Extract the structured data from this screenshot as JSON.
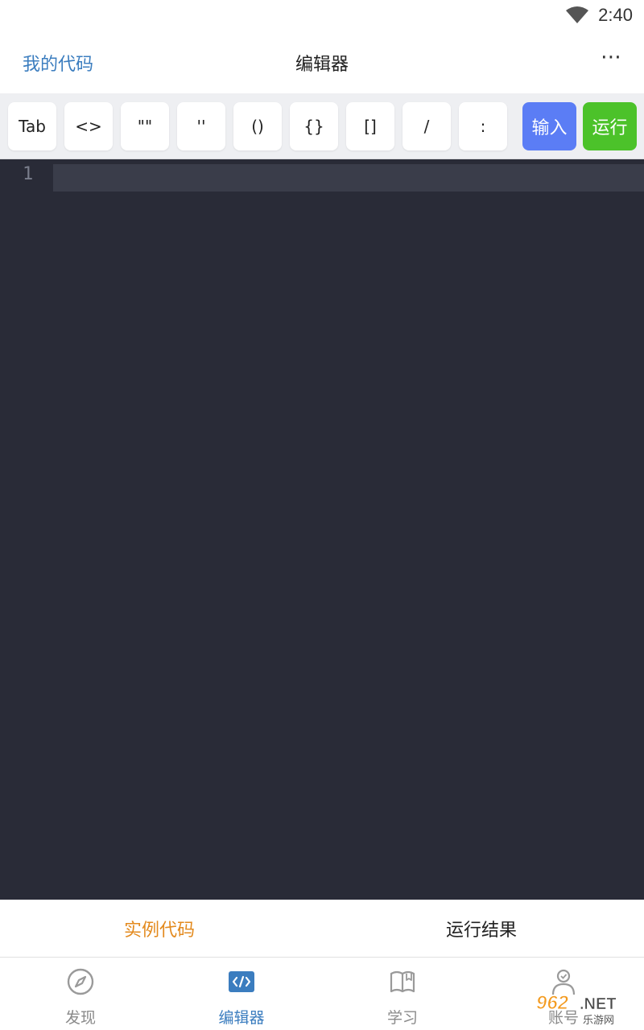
{
  "status_bar": {
    "time": "2:40",
    "wifi_icon": "wifi-icon"
  },
  "nav": {
    "left_link": "我的代码",
    "title": "编辑器",
    "more": "⋯"
  },
  "toolbar": {
    "keys": [
      "Tab",
      "<>",
      "\"\"",
      "''",
      "()",
      "{}",
      "[]",
      "/",
      ":"
    ],
    "input_label": "输入",
    "run_label": "运行",
    "input_color": "#5b7df5",
    "run_color": "#4cc22a"
  },
  "editor": {
    "line_numbers": [
      "1"
    ],
    "background": "#292b37"
  },
  "result_tabs": {
    "example_code": "实例代码",
    "run_result": "运行结果",
    "active_color": "#e38a1e"
  },
  "bottom_nav": {
    "items": [
      {
        "label": "发现",
        "icon": "compass-icon"
      },
      {
        "label": "编辑器",
        "icon": "code-icon"
      },
      {
        "label": "学习",
        "icon": "book-icon"
      },
      {
        "label": "账号",
        "icon": "user-icon"
      }
    ],
    "active_color": "#3b7dbf"
  },
  "watermark": {
    "logo": "962.NET",
    "sub": "乐游网"
  }
}
